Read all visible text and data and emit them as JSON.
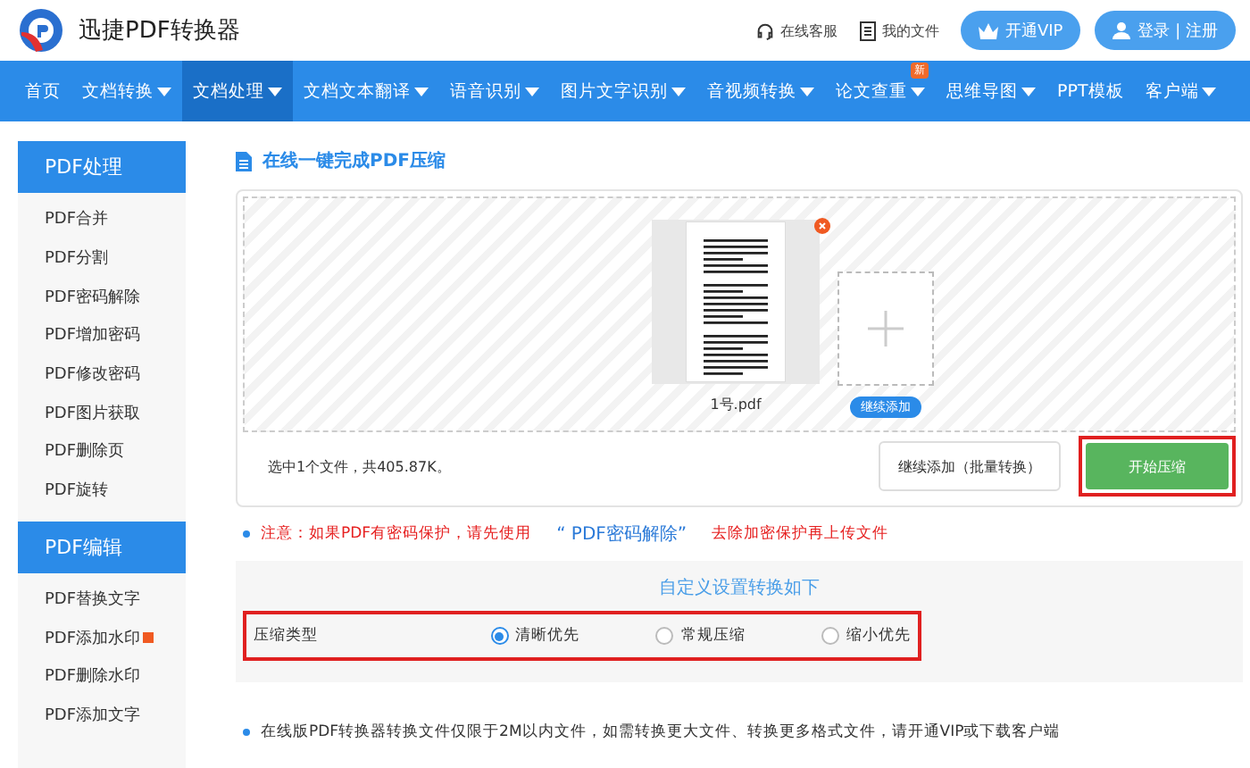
{
  "header": {
    "logo_text": "迅捷PDF转换器",
    "links": [
      {
        "kind": "support",
        "label": "在线客服"
      },
      {
        "kind": "files",
        "label": "我的文件"
      }
    ],
    "vip_button": "开通VIP",
    "login_button": "登录 | 注册"
  },
  "nav": [
    {
      "label": "首页",
      "dropdown": false,
      "selected": false
    },
    {
      "label": "文档转换",
      "dropdown": true,
      "selected": false
    },
    {
      "label": "文档处理",
      "dropdown": true,
      "selected": true
    },
    {
      "label": "文档文本翻译",
      "dropdown": true,
      "selected": false
    },
    {
      "label": "语音识别",
      "dropdown": true,
      "selected": false
    },
    {
      "label": "图片文字识别",
      "dropdown": true,
      "selected": false
    },
    {
      "label": "音视频转换",
      "dropdown": true,
      "selected": false
    },
    {
      "label": "论文查重",
      "dropdown": true,
      "selected": false,
      "badge": "新"
    },
    {
      "label": "思维导图",
      "dropdown": true,
      "selected": false
    },
    {
      "label": "PPT模板",
      "dropdown": false,
      "selected": false
    },
    {
      "label": "客户端",
      "dropdown": true,
      "selected": false
    }
  ],
  "sidebar": [
    {
      "title": "PDF处理",
      "items": [
        {
          "label": "PDF合并"
        },
        {
          "label": "PDF分割"
        },
        {
          "label": "PDF密码解除"
        },
        {
          "label": "PDF增加密码"
        },
        {
          "label": "PDF修改密码"
        },
        {
          "label": "PDF图片获取"
        },
        {
          "label": "PDF删除页"
        },
        {
          "label": "PDF旋转"
        }
      ]
    },
    {
      "title": "PDF编辑",
      "items": [
        {
          "label": "PDF替换文字"
        },
        {
          "label": "PDF添加水印",
          "hot": true
        },
        {
          "label": "PDF删除水印"
        },
        {
          "label": "PDF添加文字"
        }
      ]
    }
  ],
  "main": {
    "title": "在线一键完成PDF压缩",
    "upload": {
      "files": [
        {
          "name": "1号.pdf"
        }
      ],
      "add_label": "继续添加"
    },
    "summary": "选中1个文件，共405.87K。",
    "batch_button": "继续添加（批量转换）",
    "start_button": "开始压缩",
    "start_highlighted": true,
    "notice": {
      "before": "注意：如果PDF有密码保护，请先使用",
      "link": "“ PDF密码解除”",
      "after": "去除加密保护再上传文件"
    },
    "settings": {
      "title": "自定义设置转换如下",
      "label": "压缩类型",
      "highlighted": true,
      "options": [
        {
          "label": "清晰优先",
          "selected": true
        },
        {
          "label": "常规压缩",
          "selected": false
        },
        {
          "label": "缩小优先",
          "selected": false
        }
      ]
    },
    "footnote": "在线版PDF转换器转换文件仅限于2M以内文件，如需转换更大文件、转换更多格式文件，请开通VIP或下载客户端"
  }
}
